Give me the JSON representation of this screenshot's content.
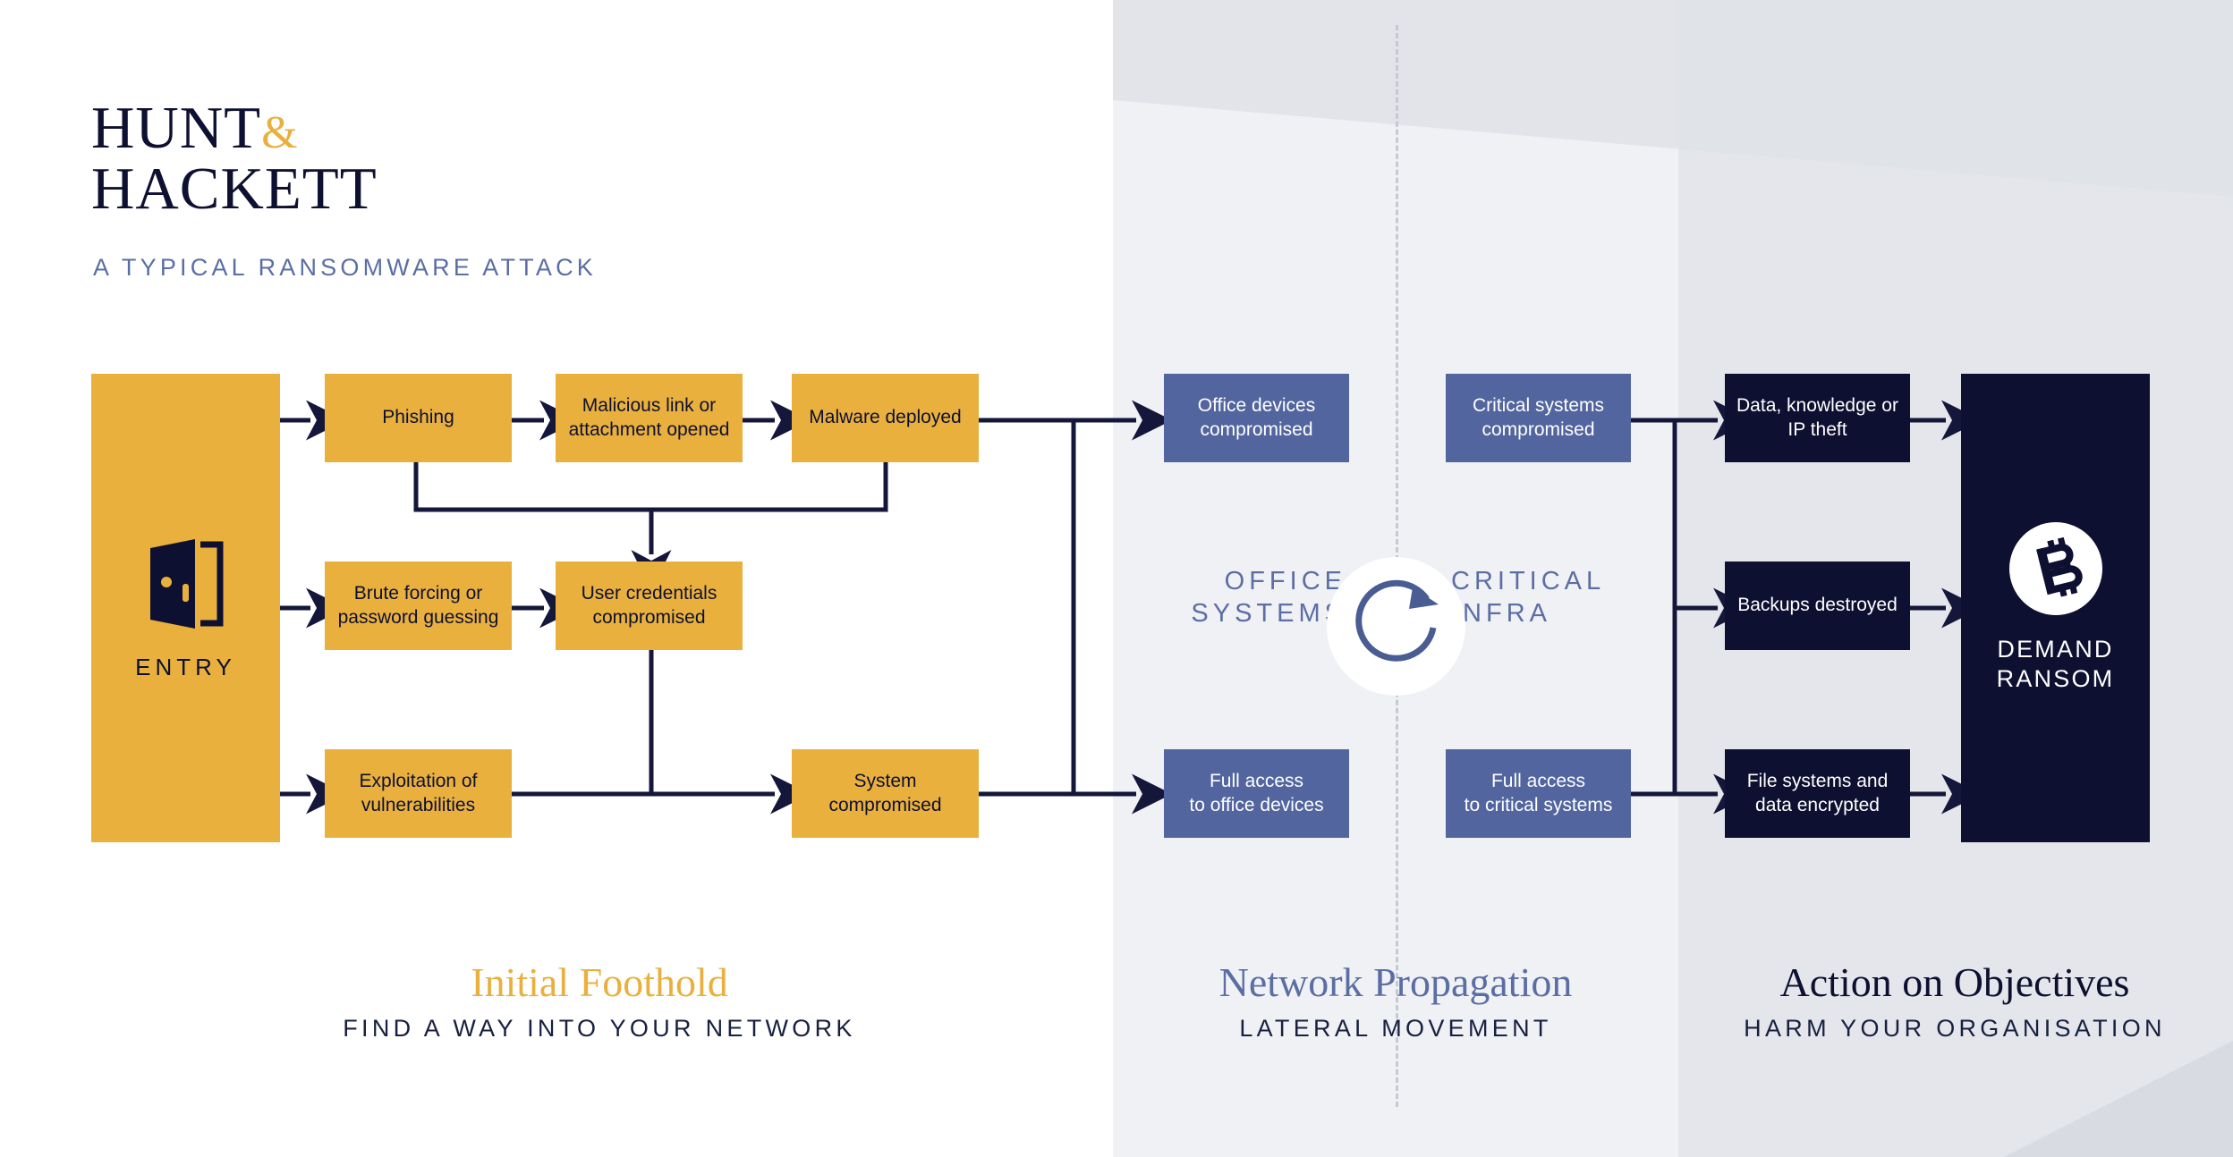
{
  "brand": {
    "line1_a": "HUNT",
    "line1_amp": "&",
    "line2": "HACKETT",
    "subtitle": "A TYPICAL RANSOMWARE ATTACK"
  },
  "entry": {
    "label": "ENTRY",
    "icon": "open-door-icon"
  },
  "ransom": {
    "label": "DEMAND\nRANSOM",
    "icon": "bitcoin-icon"
  },
  "stage_labels": {
    "office": "OFFICE\nSYSTEMS",
    "critical": "CRITICAL\nINFRA",
    "cycle_icon": "circular-arrow-icon"
  },
  "foothold_boxes": [
    {
      "id": "phishing",
      "text": "Phishing"
    },
    {
      "id": "malicious-link",
      "text": "Malicious link or\nattachment opened"
    },
    {
      "id": "malware",
      "text": "Malware deployed"
    },
    {
      "id": "brute-force",
      "text": "Brute forcing or\npassword guessing"
    },
    {
      "id": "user-creds",
      "text": "User credentials\ncompromised"
    },
    {
      "id": "exploitation",
      "text": "Exploitation of\nvulnerabilities"
    },
    {
      "id": "system-compromised",
      "text": "System\ncompromised"
    }
  ],
  "office_boxes": [
    {
      "id": "office-devices",
      "text": "Office devices\ncompromised"
    },
    {
      "id": "full-access-office",
      "text": "Full access\nto office devices"
    }
  ],
  "critical_boxes": [
    {
      "id": "critical-systems",
      "text": "Critical systems\ncompromised"
    },
    {
      "id": "full-access-critical",
      "text": "Full access\nto critical systems"
    }
  ],
  "action_boxes": [
    {
      "id": "data-theft",
      "text": "Data, knowledge or\nIP theft"
    },
    {
      "id": "backups-destroyed",
      "text": "Backups destroyed"
    },
    {
      "id": "file-encrypted",
      "text": "File systems and\ndata encrypted"
    }
  ],
  "footers": [
    {
      "id": "initial-foothold",
      "title": "Initial Foothold",
      "subtitle": "FIND A WAY INTO YOUR NETWORK"
    },
    {
      "id": "network-propagation",
      "title": "Network Propagation",
      "subtitle": "LATERAL MOVEMENT"
    },
    {
      "id": "action-objectives",
      "title": "Action on Objectives",
      "subtitle": "HARM YOUR ORGANISATION"
    }
  ],
  "colors": {
    "amber": "#e9b03e",
    "navy": "#0d1030",
    "blue": "#52659e",
    "muted_blue": "#5b6ea4",
    "band_office": "#f0f1f5",
    "band_action": "#e4e6eb"
  }
}
